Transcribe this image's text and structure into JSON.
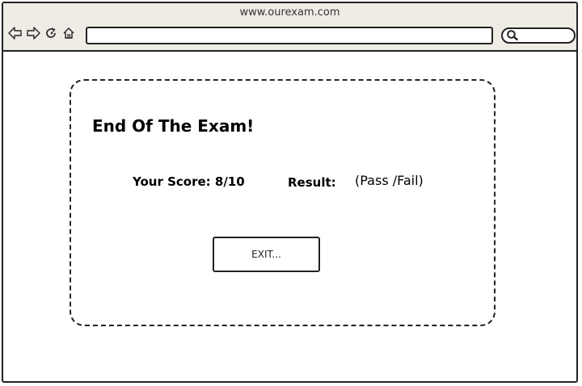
{
  "browser": {
    "url": "www.ourexam.com",
    "address_value": "",
    "search_value": "",
    "icons": [
      "back-arrow-icon",
      "forward-arrow-icon",
      "reload-icon",
      "home-icon",
      "search-icon"
    ]
  },
  "dialog": {
    "title": "End Of The Exam!",
    "score_text": "Your Score: 8/10",
    "result_label": "Result:",
    "result_value": "(Pass /Fail)",
    "exit_label": "EXIT..."
  }
}
